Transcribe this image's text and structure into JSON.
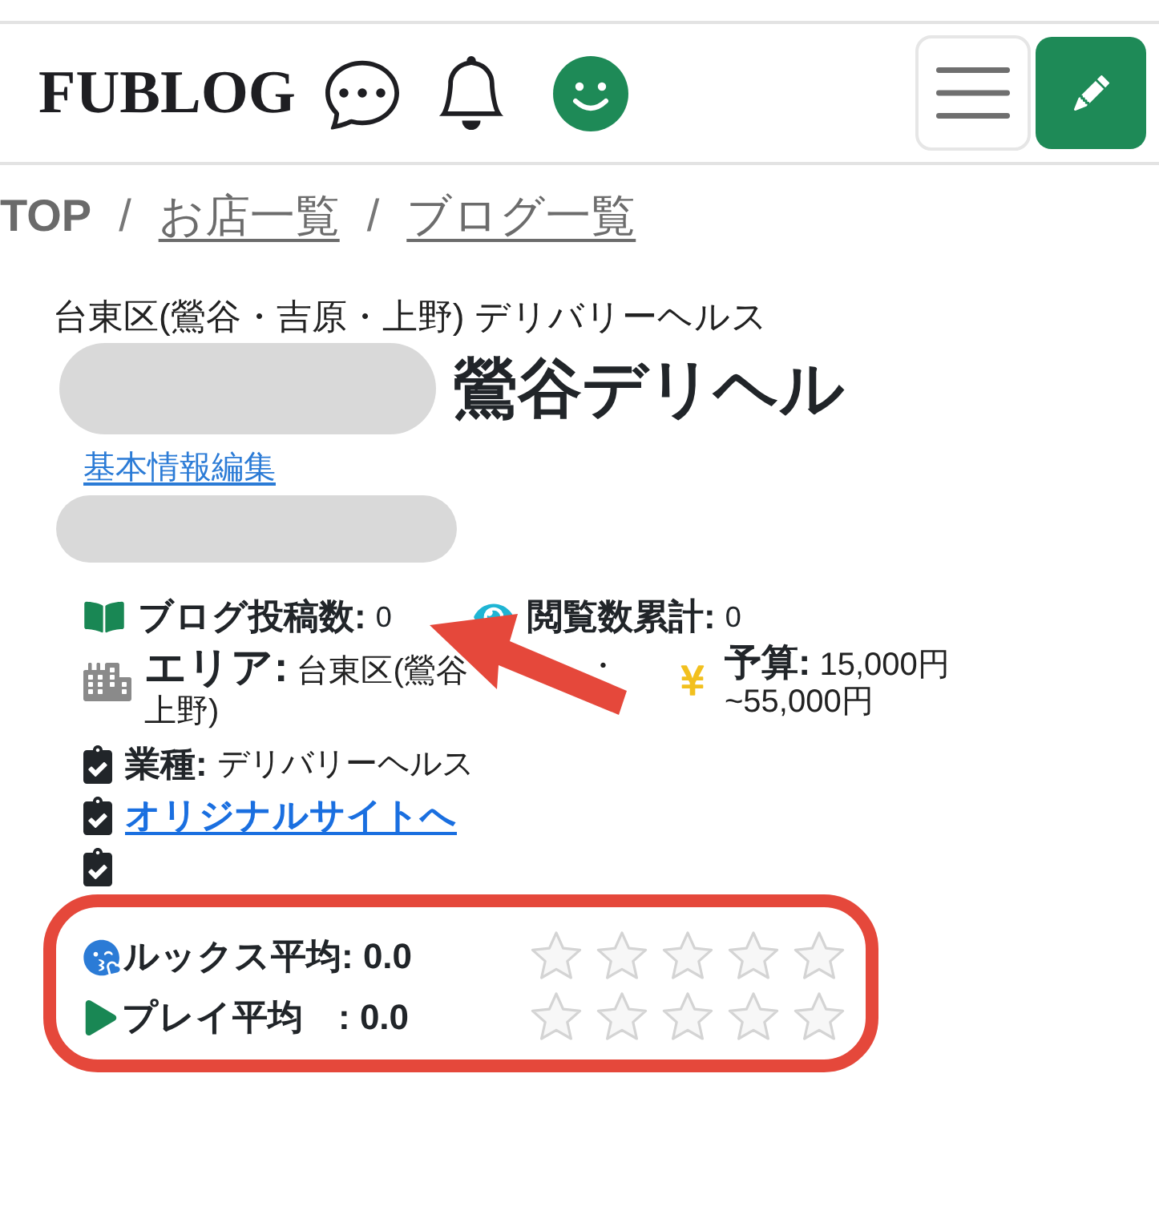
{
  "header": {
    "logo": "FUBLOG"
  },
  "breadcrumb": [
    {
      "kind": "current",
      "label": "TOP"
    },
    {
      "kind": "separator",
      "label": "/"
    },
    {
      "kind": "link",
      "label": "お店一覧"
    },
    {
      "kind": "separator",
      "label": "/"
    },
    {
      "kind": "link",
      "label": "ブログ一覧"
    }
  ],
  "shop": {
    "area_genre": "台東区(鶯谷・吉原・上野) デリバリーヘルス",
    "name": "鶯谷デリヘル",
    "edit_link": "基本情報編集"
  },
  "stats": [
    {
      "kind": "posts",
      "label": "ブログ投稿数:",
      "value": "0"
    },
    {
      "kind": "views",
      "label": "閲覧数累計:",
      "value": "0"
    }
  ],
  "details": [
    {
      "kind": "area",
      "text": "**エリア:** 台東区(鶯谷",
      "text_after_arrow": "・",
      "text_line2": "上野)"
    },
    {
      "kind": "budget",
      "text": "**予算:** 15,000円~55,000円"
    }
  ],
  "info": [
    {
      "kind": "genre",
      "label": "業種:",
      "value": "デリバリーヘルス"
    },
    {
      "kind": "link",
      "label": "オリジナルサイトへ"
    },
    {
      "kind": "blank"
    }
  ],
  "ratings": [
    {
      "kind": "looks",
      "label": "ルックス平均: 0.0",
      "stars": 0
    },
    {
      "kind": "play",
      "label": "プレイ平均　: 0.0",
      "stars": 0
    }
  ]
}
